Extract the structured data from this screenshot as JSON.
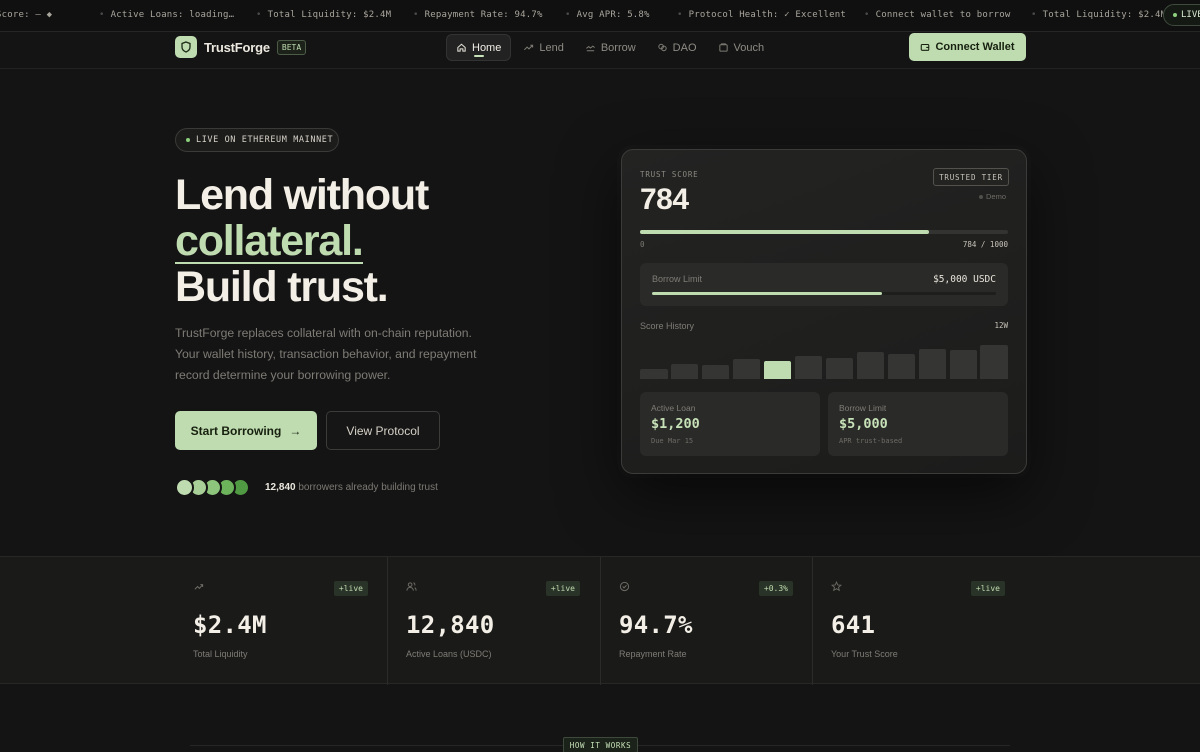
{
  "ticker": {
    "items": [
      "Score: — ◆",
      "Active Loans: loading…",
      "Total Liquidity: $2.4M",
      "Repayment Rate: 94.7%",
      "Avg APR: 5.8%",
      "Protocol Health: ✓ Excellent",
      "Connect wallet to borrow",
      "Total Liquidity: $2.4M"
    ],
    "live_label": "LIVE"
  },
  "nav": {
    "brand": "TrustForge",
    "badge": "BETA",
    "links": [
      {
        "label": "Home",
        "icon": "home-icon",
        "active": true
      },
      {
        "label": "Lend",
        "icon": "trend-icon"
      },
      {
        "label": "Borrow",
        "icon": "borrow-icon"
      },
      {
        "label": "DAO",
        "icon": "dao-icon"
      },
      {
        "label": "Vouch",
        "icon": "vouch-icon"
      }
    ],
    "connect_label": "Connect Wallet"
  },
  "hero": {
    "pill": "LIVE ON ETHEREUM MAINNET",
    "title_line1": "Lend without",
    "title_accent": "collateral.",
    "title_line3": "Build trust.",
    "description": "TrustForge replaces collateral with on-chain reputation. Your wallet history, transaction behavior, and repayment record determine your borrowing power.",
    "primary_cta": "Start Borrowing",
    "primary_arrow": "→",
    "secondary_cta": "View Protocol",
    "social_count": "12,840",
    "social_text": "borrowers already building trust",
    "avatar_colors": [
      "#bfdcb0",
      "#a9cf98",
      "#8ec57c",
      "#6db35c",
      "#4f9a42"
    ]
  },
  "card": {
    "score_label": "TRUST SCORE",
    "score": "784",
    "tier": "TRUSTED TIER",
    "demo": "Demo",
    "score_min": "0",
    "score_max": "784 / 1000",
    "score_fraction": 0.784,
    "limit_label": "Borrow Limit",
    "limit_value": "$5,000 USDC",
    "limit_fraction": 0.67,
    "history_label": "Score History",
    "history_range": "12W",
    "history_bars": [
      0.3,
      0.45,
      0.4,
      0.6,
      0.52,
      0.68,
      0.63,
      0.78,
      0.74,
      0.88,
      0.84,
      1.0
    ],
    "history_highlight": 4,
    "mini": [
      {
        "label": "Active Loan",
        "value": "$1,200",
        "sub": "Due Mar 15"
      },
      {
        "label": "Borrow Limit",
        "value": "$5,000",
        "sub": "APR trust-based"
      }
    ]
  },
  "stats": [
    {
      "icon": "trend-up-icon",
      "badge": "+live",
      "value": "$2.4M",
      "label": "Total Liquidity"
    },
    {
      "icon": "users-icon",
      "badge": "+live",
      "value": "12,840",
      "label": "Active Loans (USDC)"
    },
    {
      "icon": "check-circle-icon",
      "badge": "+0.3%",
      "value": "94.7%",
      "label": "Repayment Rate"
    },
    {
      "icon": "star-icon",
      "badge": "+live",
      "value": "641",
      "label": "Your Trust Score"
    }
  ],
  "how": {
    "badge": "HOW IT WORKS"
  },
  "colors": {
    "accent": "#bfdcb0",
    "background": "#141414"
  }
}
